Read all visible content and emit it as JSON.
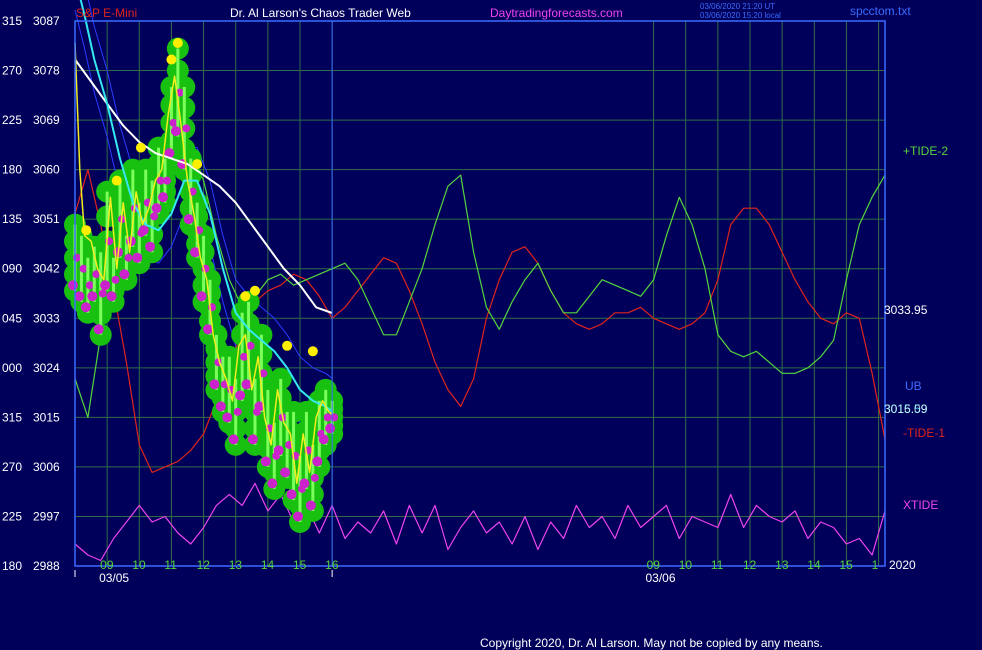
{
  "header": {
    "instrument": "S&P E-Mini",
    "title": "Dr. Al Larson's Chaos Trader Web",
    "site": "Daytradingforecasts.com",
    "stamp_line1": "03/06/2020 21:20 UT",
    "stamp_line2": "03/06/2020 15:20 local",
    "filename": "spcctom.txt"
  },
  "footer": {
    "copyright": "Copyright 2020, Dr. Al Larson. May not be copied by any means."
  },
  "colors": {
    "background": "#00005a",
    "grid": "#2e6e46",
    "frame": "#3a6cff",
    "price_axis": "#ffffff",
    "tide2": "#54d63c",
    "tide1": "#e0241c",
    "xtide": "#ee44ee",
    "white_avg": "#ffffff",
    "cyan_avg": "#34e8f0",
    "yellow_line": "#f2ee20",
    "blue_band": "#2a3cff",
    "green_fill": "#18c010",
    "magenta_dot": "#cc22cc",
    "yellow_dot": "#ffee00"
  },
  "chart_data": {
    "type": "line",
    "ylabel_left_values": [
      "315",
      "270",
      "225",
      "180",
      "135",
      "090",
      "045",
      "000",
      "315",
      "270",
      "225",
      "180"
    ],
    "ylabel_prices": [
      "3087",
      "3078",
      "3069",
      "3060",
      "3051",
      "3042",
      "3033",
      "3024",
      "3015",
      "3006",
      "2997",
      "2988"
    ],
    "ylim": [
      2988,
      3087
    ],
    "x_ticks": [
      "09",
      "10",
      "11",
      "12",
      "13",
      "14",
      "15",
      "16",
      "09",
      "10",
      "11",
      "12",
      "13",
      "14",
      "15",
      "1"
    ],
    "x_tick_hours": [
      9,
      10,
      11,
      12,
      13,
      14,
      15,
      16,
      26,
      27,
      28,
      29,
      30,
      31,
      32,
      33
    ],
    "x_day_labels": [
      "03/05",
      "03/06"
    ],
    "x_day_hours": [
      8.5,
      25.5
    ],
    "xlim": [
      8.0,
      33.2
    ],
    "day_divider_hour": 16.0,
    "year_label": "2020",
    "last_price": "3033.95",
    "right_labels": {
      "tide2": "+TIDE-2",
      "ub": "UB",
      "value_a": "3015.59",
      "value_b": "3016.09",
      "tide1": "-TIDE-1",
      "xtide": "XTIDE"
    },
    "series": [
      {
        "key": "tide2",
        "x": [
          8.0,
          8.4,
          8.8,
          9.2,
          9.6,
          10.0,
          10.4,
          10.8,
          11.2,
          11.6,
          12.0,
          12.4,
          12.8,
          13.2,
          13.6,
          14.0,
          14.4,
          14.8,
          15.2,
          15.6,
          16.0,
          16.4,
          16.8,
          17.2,
          17.6,
          18.0,
          18.4,
          18.8,
          19.2,
          19.6,
          20.0,
          20.4,
          20.8,
          21.2,
          21.6,
          22.0,
          22.4,
          22.8,
          23.2,
          23.6,
          24.0,
          24.4,
          24.8,
          25.2,
          25.6,
          26.0,
          26.4,
          26.8,
          27.2,
          27.6,
          28.0,
          28.4,
          28.8,
          29.2,
          29.6,
          30.0,
          30.4,
          30.8,
          31.2,
          31.6,
          32.0,
          32.4,
          32.8,
          33.2
        ],
        "values": [
          3022,
          3015,
          3030,
          3050,
          3055,
          3058,
          3062,
          3064,
          3066,
          3063,
          3058,
          3048,
          3040,
          3035,
          3037,
          3040,
          3041,
          3039,
          3040,
          3041,
          3042,
          3043,
          3040,
          3035,
          3030,
          3030,
          3036,
          3042,
          3050,
          3057,
          3059,
          3045,
          3035,
          3031,
          3036,
          3040,
          3043,
          3038,
          3034,
          3034,
          3037,
          3040,
          3039,
          3038,
          3037,
          3040,
          3048,
          3055,
          3050,
          3042,
          3030,
          3027,
          3026,
          3027,
          3025,
          3023,
          3023,
          3024,
          3026,
          3029,
          3040,
          3050,
          3055,
          3059
        ],
        "note": "interpolated curve approximating the +TIDE-2 line"
      },
      {
        "key": "tide1",
        "x": [
          8.0,
          8.4,
          8.8,
          9.2,
          9.6,
          10.0,
          10.4,
          10.8,
          11.2,
          11.6,
          12.0,
          12.4,
          12.8,
          13.2,
          13.6,
          14.0,
          14.4,
          14.8,
          15.2,
          15.6,
          16.0,
          16.4,
          16.8,
          17.2,
          17.6,
          18.0,
          18.4,
          18.8,
          19.2,
          19.6,
          20.0,
          20.4,
          20.8,
          21.2,
          21.6,
          22.0,
          22.4,
          22.8,
          23.2,
          23.6,
          24.0,
          24.4,
          24.8,
          25.2,
          25.6,
          26.0,
          26.4,
          26.8,
          27.2,
          27.6,
          28.0,
          28.4,
          28.8,
          29.2,
          29.6,
          30.0,
          30.4,
          30.8,
          31.2,
          31.6,
          32.0,
          32.4,
          32.8,
          33.2
        ],
        "values": [
          3052,
          3060,
          3050,
          3038,
          3025,
          3010,
          3005,
          3006,
          3007,
          3009,
          3012,
          3018,
          3025,
          3030,
          3036,
          3038,
          3039,
          3041,
          3040,
          3037,
          3033,
          3035,
          3038,
          3041,
          3044,
          3043,
          3038,
          3032,
          3025,
          3020,
          3017,
          3022,
          3033,
          3040,
          3045,
          3046,
          3043,
          3038,
          3034,
          3032,
          3031,
          3032,
          3034,
          3034,
          3035,
          3033,
          3032,
          3031,
          3032,
          3034,
          3040,
          3050,
          3053,
          3053,
          3050,
          3045,
          3040,
          3036,
          3033,
          3032,
          3034,
          3033,
          3023,
          3011
        ],
        "note": "interpolated curve approximating the -TIDE-1 line"
      },
      {
        "key": "white_avg",
        "x": [
          8.0,
          8.5,
          9.0,
          9.5,
          10.0,
          10.5,
          11.0,
          11.5,
          12.0,
          12.5,
          13.0,
          13.5,
          14.0,
          14.5,
          15.0,
          15.5,
          16.0
        ],
        "values": [
          3080,
          3076,
          3072,
          3068,
          3065,
          3063,
          3062,
          3061,
          3059,
          3057,
          3054,
          3050,
          3046,
          3042,
          3039,
          3035,
          3033.95
        ],
        "note": "slow moving average"
      },
      {
        "key": "cyan_avg",
        "x": [
          8.0,
          8.3,
          8.6,
          9.0,
          9.4,
          9.8,
          10.2,
          10.6,
          11.0,
          11.4,
          11.8,
          12.2,
          12.6,
          13.0,
          13.4,
          13.8,
          14.2,
          14.6,
          15.0,
          15.4,
          15.8,
          16.0
        ],
        "values": [
          3095,
          3088,
          3080,
          3072,
          3062,
          3054,
          3050,
          3049,
          3052,
          3058,
          3058,
          3052,
          3042,
          3034,
          3031,
          3029,
          3027,
          3024,
          3020,
          3018,
          3017,
          3016.09
        ],
        "note": "fast moving average"
      },
      {
        "key": "yellow_line",
        "x": [
          8.0,
          8.15,
          8.3,
          8.5,
          8.7,
          8.9,
          9.1,
          9.3,
          9.5,
          9.7,
          9.9,
          10.1,
          10.3,
          10.5,
          10.7,
          10.9,
          11.1,
          11.3,
          11.5,
          11.7,
          11.9,
          12.1,
          12.3,
          12.5,
          12.7,
          12.9,
          13.1,
          13.3,
          13.5,
          13.7,
          13.9,
          14.1,
          14.3,
          14.5,
          14.7,
          14.9,
          15.1,
          15.3,
          15.5,
          15.7,
          15.9,
          16.0
        ],
        "values": [
          3083,
          3060,
          3048,
          3047,
          3042,
          3040,
          3055,
          3042,
          3054,
          3045,
          3056,
          3050,
          3053,
          3058,
          3060,
          3070,
          3077,
          3068,
          3058,
          3052,
          3044,
          3040,
          3030,
          3025,
          3022,
          3018,
          3028,
          3030,
          3020,
          3026,
          3015,
          3010,
          3020,
          3014,
          3012,
          3003,
          3012,
          3005,
          3015,
          3018,
          3016,
          3015.59
        ],
        "note": "price-following smoothed line"
      },
      {
        "key": "xtide",
        "x": [
          8.0,
          8.4,
          8.8,
          9.2,
          9.6,
          10.0,
          10.4,
          10.8,
          11.2,
          11.6,
          12.0,
          12.4,
          12.8,
          13.2,
          13.6,
          14.0,
          14.4,
          14.8,
          15.2,
          15.6,
          16.0,
          16.4,
          16.8,
          17.2,
          17.6,
          18.0,
          18.4,
          18.8,
          19.2,
          19.6,
          20.0,
          20.4,
          20.8,
          21.2,
          21.6,
          22.0,
          22.4,
          22.8,
          23.2,
          23.6,
          24.0,
          24.4,
          24.8,
          25.2,
          25.6,
          26.0,
          26.4,
          26.8,
          27.2,
          27.6,
          28.0,
          28.4,
          28.8,
          29.2,
          29.6,
          30.0,
          30.4,
          30.8,
          31.2,
          31.6,
          32.0,
          32.4,
          32.8,
          33.2
        ],
        "values": [
          2992,
          2990,
          2989,
          2993,
          2996,
          2999,
          2996,
          2997,
          2994,
          2992,
          2995,
          2999,
          3001,
          2999,
          3003,
          2998,
          3001,
          2996,
          2999,
          2994,
          2999,
          2993,
          2996,
          2994,
          2998,
          2992,
          2999,
          2994,
          2999,
          2991,
          2995,
          2998,
          2994,
          2996,
          2992,
          2997,
          2991,
          2996,
          2993,
          2999,
          2995,
          2997,
          2993,
          2999,
          2995,
          2997,
          2999,
          2993,
          2997,
          2996,
          2995,
          3001,
          2995,
          2999,
          2997,
          2996,
          2998,
          2993,
          2996,
          2995,
          2992,
          2993,
          2990,
          2998
        ],
        "note": "interpolated curve approximating the XTIDE line"
      }
    ],
    "price_points": {
      "x": [
        8.0,
        8.2,
        8.4,
        8.6,
        8.8,
        9.0,
        9.2,
        9.4,
        9.6,
        9.8,
        10.0,
        10.2,
        10.4,
        10.6,
        10.8,
        11.0,
        11.2,
        11.4,
        11.6,
        11.8,
        12.0,
        12.2,
        12.4,
        12.6,
        12.8,
        13.0,
        13.2,
        13.4,
        13.6,
        13.8,
        14.0,
        14.2,
        14.4,
        14.6,
        14.8,
        15.0,
        15.2,
        15.4,
        15.6,
        15.8,
        16.0
      ],
      "high": [
        3050,
        3048,
        3044,
        3046,
        3045,
        3056,
        3044,
        3058,
        3048,
        3060,
        3054,
        3060,
        3058,
        3064,
        3062,
        3075,
        3082,
        3075,
        3062,
        3054,
        3048,
        3040,
        3030,
        3026,
        3026,
        3022,
        3034,
        3036,
        3022,
        3030,
        3020,
        3014,
        3022,
        3016,
        3016,
        3008,
        3016,
        3010,
        3018,
        3020,
        3018
      ],
      "low": [
        3038,
        3036,
        3034,
        3036,
        3030,
        3038,
        3036,
        3044,
        3040,
        3046,
        3043,
        3048,
        3045,
        3052,
        3054,
        3062,
        3066,
        3060,
        3050,
        3044,
        3036,
        3030,
        3020,
        3016,
        3014,
        3010,
        3018,
        3020,
        3010,
        3016,
        3006,
        3002,
        3008,
        3004,
        3000,
        2996,
        3002,
        2998,
        3006,
        3010,
        3012
      ]
    },
    "peak_markers_x": [
      8.35,
      9.3,
      10.05,
      11.0,
      11.2,
      11.8,
      13.3,
      13.6,
      14.6,
      15.4
    ],
    "peak_markers_y": [
      3049,
      3058,
      3064,
      3080,
      3083,
      3061,
      3037,
      3038,
      3028,
      3027
    ],
    "grid": true
  }
}
